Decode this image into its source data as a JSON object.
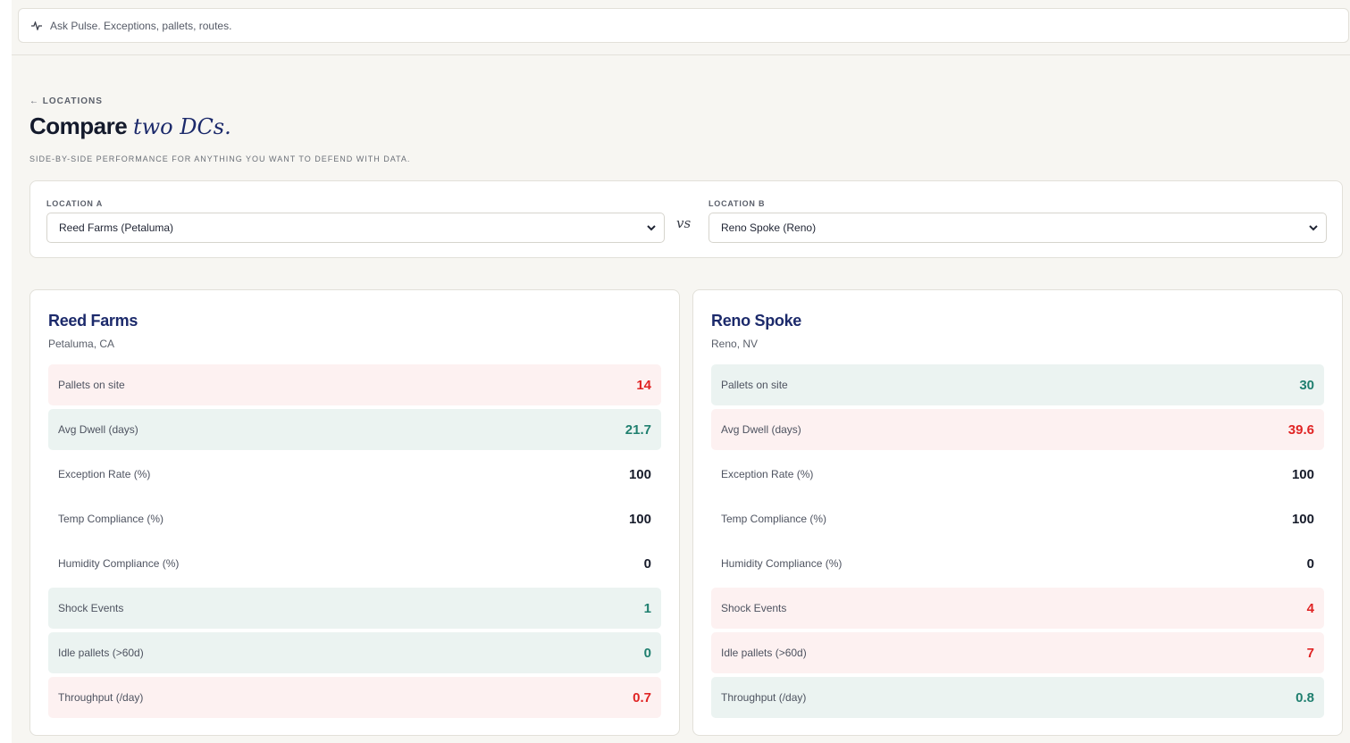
{
  "search": {
    "placeholder": "Ask Pulse. Exceptions, pallets, routes."
  },
  "header": {
    "breadcrumb": "← LOCATIONS",
    "title_main": "Compare",
    "title_accent": "two DCs.",
    "subtitle": "SIDE-BY-SIDE PERFORMANCE FOR ANYTHING YOU WANT TO DEFEND WITH DATA."
  },
  "selector": {
    "location_a_label": "LOCATION A",
    "location_a_value": "Reed Farms (Petaluma)",
    "vs_label": "vs",
    "location_b_label": "LOCATION B",
    "location_b_value": "Reno Spoke (Reno)"
  },
  "colors": {
    "bad": "#e02424",
    "good": "#1f7f6f",
    "accent": "#1c2a6b"
  },
  "locations": [
    {
      "name": "Reed Farms",
      "place": "Petaluma, CA",
      "metrics": [
        {
          "label": "Pallets on site",
          "value": "14",
          "status": "bad"
        },
        {
          "label": "Avg Dwell (days)",
          "value": "21.7",
          "status": "good"
        },
        {
          "label": "Exception Rate (%)",
          "value": "100",
          "status": "neutral"
        },
        {
          "label": "Temp Compliance (%)",
          "value": "100",
          "status": "neutral"
        },
        {
          "label": "Humidity Compliance (%)",
          "value": "0",
          "status": "neutral"
        },
        {
          "label": "Shock Events",
          "value": "1",
          "status": "good"
        },
        {
          "label": "Idle pallets (>60d)",
          "value": "0",
          "status": "good"
        },
        {
          "label": "Throughput (/day)",
          "value": "0.7",
          "status": "bad"
        }
      ]
    },
    {
      "name": "Reno Spoke",
      "place": "Reno, NV",
      "metrics": [
        {
          "label": "Pallets on site",
          "value": "30",
          "status": "good"
        },
        {
          "label": "Avg Dwell (days)",
          "value": "39.6",
          "status": "bad"
        },
        {
          "label": "Exception Rate (%)",
          "value": "100",
          "status": "neutral"
        },
        {
          "label": "Temp Compliance (%)",
          "value": "100",
          "status": "neutral"
        },
        {
          "label": "Humidity Compliance (%)",
          "value": "0",
          "status": "neutral"
        },
        {
          "label": "Shock Events",
          "value": "4",
          "status": "bad"
        },
        {
          "label": "Idle pallets (>60d)",
          "value": "7",
          "status": "bad"
        },
        {
          "label": "Throughput (/day)",
          "value": "0.8",
          "status": "good"
        }
      ]
    }
  ]
}
